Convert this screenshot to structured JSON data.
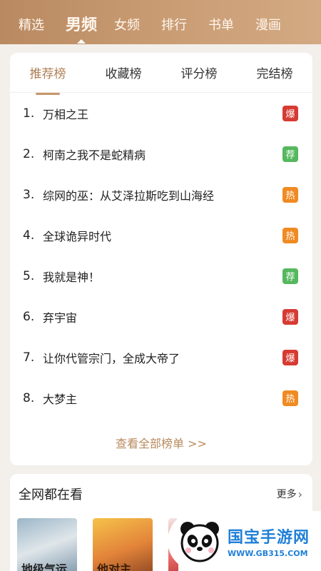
{
  "top_nav": {
    "items": [
      {
        "label": "精选",
        "active": false
      },
      {
        "label": "男频",
        "active": true
      },
      {
        "label": "女频",
        "active": false
      },
      {
        "label": "排行",
        "active": false
      },
      {
        "label": "书单",
        "active": false
      },
      {
        "label": "漫画",
        "active": false
      }
    ]
  },
  "rank_card": {
    "tabs": [
      {
        "label": "推荐榜",
        "active": true
      },
      {
        "label": "收藏榜",
        "active": false
      },
      {
        "label": "评分榜",
        "active": false
      },
      {
        "label": "完结榜",
        "active": false
      }
    ],
    "items": [
      {
        "num": "1.",
        "title": "万相之王",
        "badge": "爆",
        "badge_color": "#d63b33"
      },
      {
        "num": "2.",
        "title": "柯南之我不是蛇精病",
        "badge": "荐",
        "badge_color": "#56b85e"
      },
      {
        "num": "3.",
        "title": "综网的巫：从艾泽拉斯吃到山海经",
        "badge": "热",
        "badge_color": "#f08a22"
      },
      {
        "num": "4.",
        "title": "全球诡异时代",
        "badge": "热",
        "badge_color": "#f08a22"
      },
      {
        "num": "5.",
        "title": "我就是神！",
        "badge": "荐",
        "badge_color": "#56b85e"
      },
      {
        "num": "6.",
        "title": "弃宇宙",
        "badge": "爆",
        "badge_color": "#d63b33"
      },
      {
        "num": "7.",
        "title": "让你代管宗门，全成大帝了",
        "badge": "爆",
        "badge_color": "#d63b33"
      },
      {
        "num": "8.",
        "title": "大梦主",
        "badge": "热",
        "badge_color": "#f08a22"
      }
    ],
    "view_all": "查看全部榜单 >>"
  },
  "hot_section": {
    "title": "全网都在看",
    "more": "更多",
    "covers": [
      {
        "text": "地级气运"
      },
      {
        "text": "他对主"
      },
      {
        "text": ""
      }
    ]
  },
  "watermark": {
    "name": "国宝手游网",
    "url": "WWW.GB315.COM"
  },
  "colors": {
    "accent": "#b07f55",
    "header_gradient": [
      "#b98a62",
      "#d3aa83"
    ]
  }
}
